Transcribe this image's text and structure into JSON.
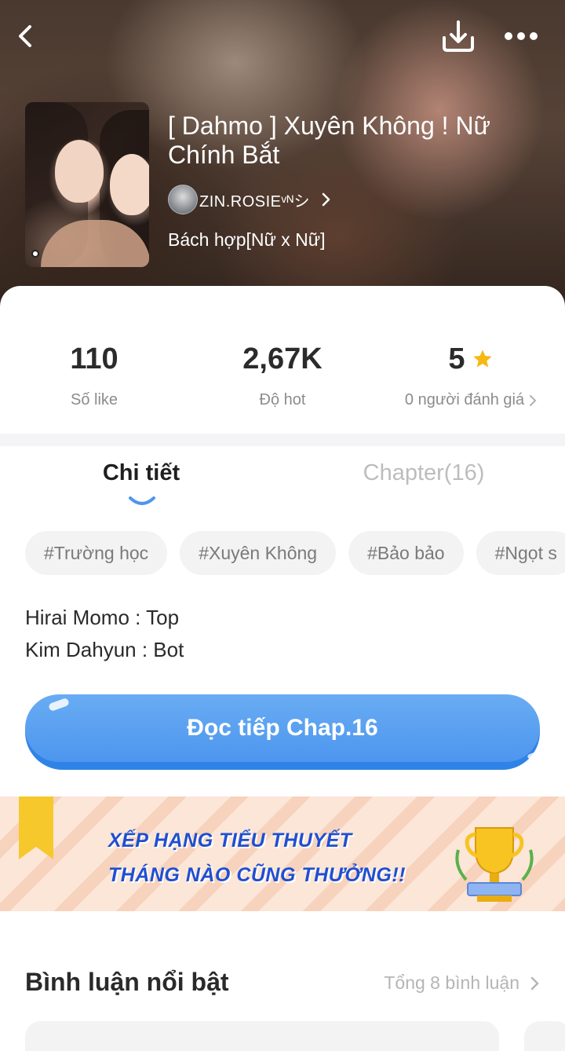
{
  "header": {
    "back_icon": "chevron-left-icon",
    "download_icon": "download-icon",
    "more_icon": "more-dots-icon"
  },
  "story": {
    "title": "[ Dahmo ] Xuyên Không ! Nữ Chính Bắt",
    "author": "ZIN.ROSIEᵛᴺシ",
    "genre": "Bách hợp[Nữ x Nữ]"
  },
  "stats": {
    "likes_value": "110",
    "likes_label": "Số like",
    "hot_value": "2,67K",
    "hot_label": "Độ hot",
    "rating_value": "5",
    "rating_label": "0 người đánh giá"
  },
  "tabs": {
    "detail": "Chi tiết",
    "chapter": "Chapter(16)"
  },
  "tags": [
    "#Trường học",
    "#Xuyên Không",
    "#Bảo bảo",
    "#Ngọt s"
  ],
  "description": [
    "Hirai Momo : Top",
    "Kim Dahyun : Bot"
  ],
  "read_button": "Đọc tiếp Chap.16",
  "banner": {
    "line1": "XẾP HẠNG TIỂU THUYẾT",
    "line2": "THÁNG NÀO CŨNG THƯỞNG!!"
  },
  "comments": {
    "title": "Bình luận nổi bật",
    "total": "Tổng 8 bình luận"
  },
  "colors": {
    "accent": "#4d96ef",
    "star": "#f6b914",
    "banner_text": "#1f4fd1"
  }
}
